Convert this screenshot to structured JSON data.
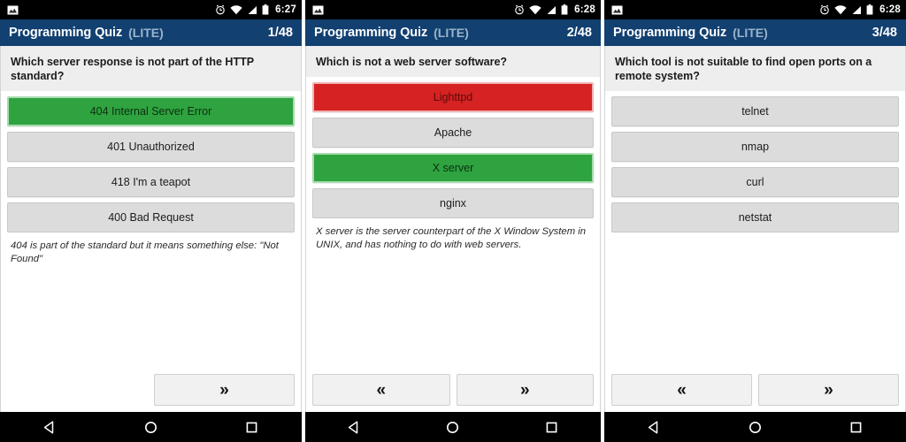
{
  "app": {
    "title": "Programming Quiz",
    "edition": "(LITE)"
  },
  "icons": {
    "status_left": "image-notification-icon",
    "alarm": "alarm-clock-icon",
    "wifi": "wifi-icon",
    "signal": "cell-signal-icon",
    "battery": "battery-icon",
    "back": "back-triangle-icon",
    "home": "home-circle-icon",
    "recents": "recents-square-icon",
    "prev": "double-chevron-left-icon",
    "next": "double-chevron-right-icon"
  },
  "colors": {
    "header_blue": "#124070",
    "correct_green": "#2ea33f",
    "wrong_red": "#d62222",
    "option_gray": "#dcdcdc",
    "question_bg": "#eeeeee",
    "statusbar_black": "#000000"
  },
  "nav_labels": {
    "prev": "«",
    "next": "»"
  },
  "screens": [
    {
      "status": {
        "time": "6:27"
      },
      "counter": "1/48",
      "question": "Which server response is not part of the HTTP standard?",
      "options": [
        {
          "label": "404 Internal Server Error",
          "state": "correct"
        },
        {
          "label": "401 Unauthorized",
          "state": "normal"
        },
        {
          "label": "418 I'm a teapot",
          "state": "normal"
        },
        {
          "label": "400 Bad Request",
          "state": "normal"
        }
      ],
      "explanation": "404 is part of the standard but it means something else: \"Not Found\"",
      "has_prev": false,
      "has_next": true
    },
    {
      "status": {
        "time": "6:28"
      },
      "counter": "2/48",
      "question": "Which is not a web server software?",
      "options": [
        {
          "label": "Lighttpd",
          "state": "wrong"
        },
        {
          "label": "Apache",
          "state": "normal"
        },
        {
          "label": "X server",
          "state": "correct"
        },
        {
          "label": "nginx",
          "state": "normal"
        }
      ],
      "explanation": "X server is the server counterpart of the X Window System in UNIX, and has nothing to do with web servers.",
      "has_prev": true,
      "has_next": true
    },
    {
      "status": {
        "time": "6:28"
      },
      "counter": "3/48",
      "question": "Which tool is not suitable to find open ports on a remote system?",
      "options": [
        {
          "label": "telnet",
          "state": "normal"
        },
        {
          "label": "nmap",
          "state": "normal"
        },
        {
          "label": "curl",
          "state": "normal"
        },
        {
          "label": "netstat",
          "state": "normal"
        }
      ],
      "explanation": "",
      "has_prev": true,
      "has_next": true
    }
  ]
}
